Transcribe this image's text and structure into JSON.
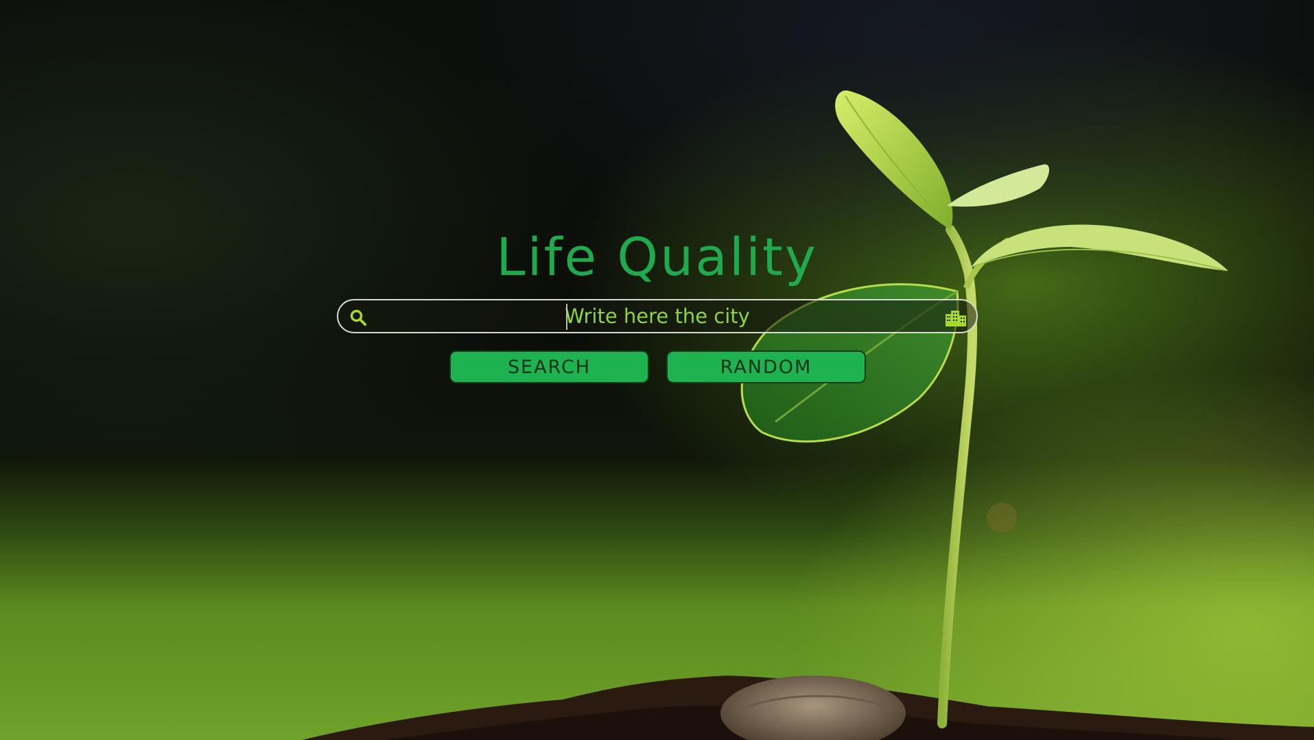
{
  "app": {
    "title": "Life Quality"
  },
  "search": {
    "placeholder": "Write here the city",
    "value": "",
    "leading_icon": "search-icon",
    "trailing_icon": "city-buildings-icon"
  },
  "actions": {
    "search_label": "SEARCH",
    "random_label": "RANDOM"
  },
  "colors": {
    "title": "#1faa4e",
    "button_fill": "#1fb250",
    "placeholder": "#8fd63a",
    "icon": "#a6d92e"
  }
}
